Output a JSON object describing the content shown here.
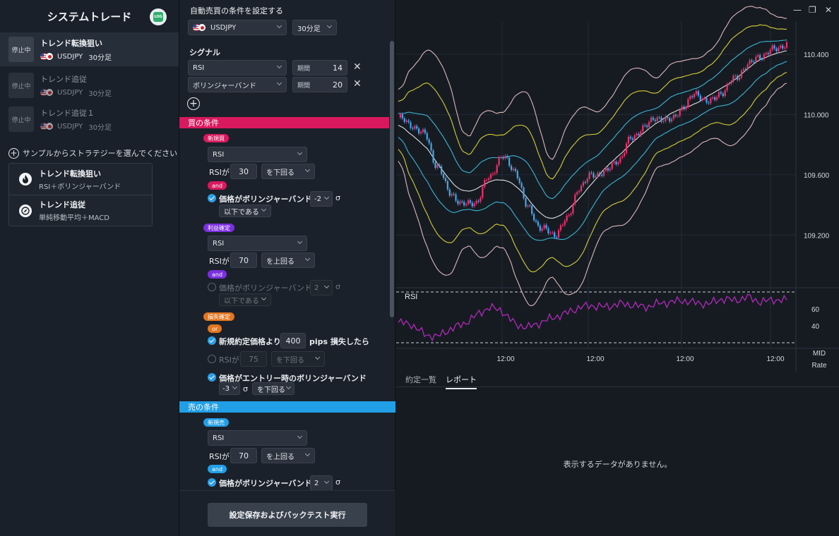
{
  "sidebar": {
    "title": "システムトレード",
    "badge": "LOG",
    "strategies": [
      {
        "status": "停止中",
        "name": "トレンド転換狙い",
        "pair": "USDJPY",
        "timeframe": "30分足",
        "active": true
      },
      {
        "status": "停止中",
        "name": "トレンド追従",
        "pair": "USDJPY",
        "timeframe": "30分足",
        "active": false
      },
      {
        "status": "停止中",
        "name": "トレンド追従１",
        "pair": "USDJPY",
        "timeframe": "30分足",
        "active": false
      }
    ],
    "sample_prompt": "サンプルからストラテジーを選んでください",
    "samples": [
      {
        "title": "トレンド転換狙い",
        "desc": "RSI＋ボリンジャーバンド"
      },
      {
        "title": "トレンド追従",
        "desc": "単純移動平均＋MACD"
      }
    ]
  },
  "config": {
    "title": "自動売買の条件を設定する",
    "pair": "USDJPY",
    "timeframe": "30分足",
    "signal_heading": "シグナル",
    "signals": [
      {
        "indicator": "RSI",
        "period_label": "期間",
        "period": "14"
      },
      {
        "indicator": "ボリンジャーバンド",
        "period_label": "期間",
        "period": "20"
      }
    ],
    "buy": {
      "heading": "買の条件",
      "new": {
        "pill": "新規買",
        "indicator": "RSI",
        "rsi_label": "RSIが",
        "rsi_value": "30",
        "rsi_cmp": "を下回る",
        "joiner": "and",
        "bb_label": "価格がボリンジャーバンド",
        "bb_sigma": "-2",
        "sigma": "σ",
        "bb_cmp": "以下である"
      },
      "profit": {
        "pill": "利益確定",
        "indicator": "RSI",
        "rsi_label": "RSIが",
        "rsi_value": "70",
        "rsi_cmp": "を上回る",
        "joiner": "and",
        "bb_label": "価格がボリンジャーバンド",
        "bb_sigma": "2",
        "sigma": "σ",
        "bb_cmp": "以下である"
      },
      "loss": {
        "pill": "損失確定",
        "joiner": "or",
        "pips_prefix": "新規約定価格より",
        "pips_value": "400",
        "pips_suffix": "pips 損失したら",
        "rsi_label": "RSIが",
        "rsi_value": "75",
        "rsi_cmp": "を下回る",
        "entry_label": "価格がエントリー時のボリンジャーバンド",
        "entry_sigma": "-3",
        "sigma": "σ",
        "entry_cmp": "を下回る"
      }
    },
    "sell": {
      "heading": "売の条件",
      "new": {
        "pill": "新規売",
        "indicator": "RSI",
        "rsi_label": "RSIが",
        "rsi_value": "70",
        "rsi_cmp": "を上回る",
        "joiner": "and",
        "bb_label": "価格がボリンジャーバンド",
        "bb_sigma": "2",
        "sigma": "σ"
      }
    },
    "run_button": "設定保存およびバックテスト実行"
  },
  "chart": {
    "window_controls": [
      "—",
      "❐",
      "✕"
    ],
    "price_ticks": [
      "110.400",
      "110.000",
      "109.600",
      "109.200"
    ],
    "rsi_label": "RSI",
    "rsi_ticks": [
      "60",
      "40"
    ],
    "time_ticks": [
      "12:00",
      "12:00",
      "12:00",
      "12:00"
    ],
    "axis_caption": [
      "MID",
      "Rate"
    ]
  },
  "chart_data": {
    "type": "line",
    "description_series": [
      "price",
      "bollinger bands",
      "RSI"
    ],
    "y_ticks": [
      110.4,
      110.0,
      109.6,
      109.2
    ],
    "ylim": [
      108.85,
      110.62
    ],
    "rsi_ticks": [
      60,
      40
    ],
    "x_ticks": [
      "12:00",
      "12:00",
      "12:00",
      "12:00"
    ],
    "x": [
      0,
      3,
      6,
      9,
      12,
      15,
      18,
      21,
      24,
      27,
      30,
      33,
      36,
      39,
      42,
      45,
      48,
      51,
      54,
      57,
      60,
      63,
      66,
      69,
      72,
      75,
      78,
      81,
      84,
      87,
      90
    ],
    "series": [
      {
        "values": [
          109.98,
          109.93,
          109.87,
          109.66,
          109.48,
          109.4,
          109.42,
          109.58,
          109.72,
          109.63,
          109.38,
          109.25,
          109.2,
          109.3,
          109.52,
          109.6,
          109.62,
          109.7,
          109.84,
          109.92,
          109.98,
          109.96,
          110.05,
          110.14,
          110.08,
          110.15,
          110.24,
          110.33,
          110.39,
          110.43,
          110.47
        ]
      },
      {
        "values": [
          44,
          42,
          30,
          27,
          36,
          42,
          52,
          62,
          58,
          42,
          38,
          44,
          50,
          55,
          62,
          64,
          62,
          66,
          65,
          62,
          66,
          68,
          70,
          67,
          66,
          72,
          70,
          74,
          68,
          71,
          70
        ]
      }
    ]
  },
  "report": {
    "tabs": [
      "約定一覧",
      "レポート"
    ],
    "empty_message": "表示するデータがありません。"
  }
}
